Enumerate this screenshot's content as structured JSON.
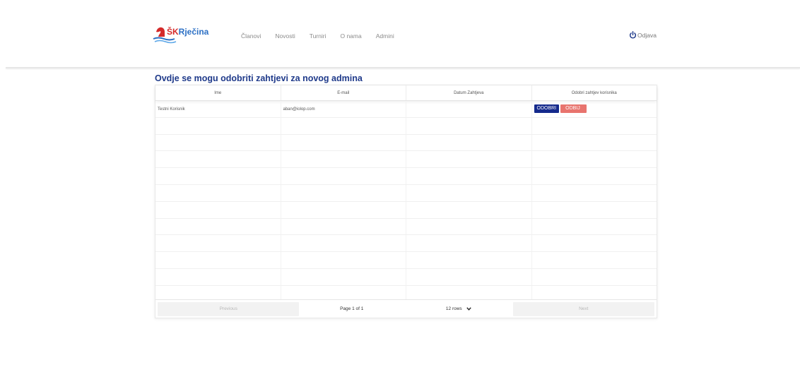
{
  "brand": {
    "prefix": "ŠK",
    "name": "Rječina"
  },
  "nav": {
    "items": [
      {
        "label": "Članovi"
      },
      {
        "label": "Novosti"
      },
      {
        "label": "Turniri"
      },
      {
        "label": "O nama"
      },
      {
        "label": "Admini"
      }
    ],
    "logout_label": "Odjava"
  },
  "page": {
    "title": "Ovdje se mogu odobriti zahtjevi za novog admina"
  },
  "table": {
    "columns": [
      "Ime",
      "E-mail",
      "Datum Zahtjeva",
      "Odobri zahtjev korisnika"
    ],
    "rows": [
      {
        "name": "Testni Korisnik",
        "email": "aban@iolop.com",
        "date": "",
        "approve_label": "ODOBRI",
        "reject_label": "ODBIJ"
      }
    ]
  },
  "pagination": {
    "previous_label": "Previous",
    "page_info": "Page 1 of 1",
    "rows_select": "12 rows",
    "next_label": "Next"
  },
  "colors": {
    "primary": "#152a8c",
    "danger": "#e8746e",
    "title": "#1f3a8a",
    "brand_blue": "#2b6fc4",
    "brand_red": "#d42a2a"
  }
}
